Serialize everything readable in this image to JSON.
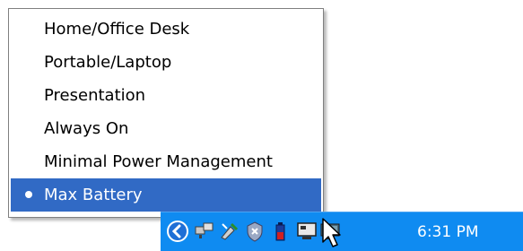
{
  "power_menu": {
    "items": [
      {
        "label": "Home/Office Desk",
        "selected": false
      },
      {
        "label": "Portable/Laptop",
        "selected": false
      },
      {
        "label": "Presentation",
        "selected": false
      },
      {
        "label": "Always On",
        "selected": false
      },
      {
        "label": "Minimal Power Management",
        "selected": false
      },
      {
        "label": "Max Battery",
        "selected": true
      }
    ]
  },
  "taskbar": {
    "clock": "6:31 PM",
    "tray_icons": [
      "show-hidden-icons-chevron-icon",
      "network-icon",
      "safely-remove-hardware-icon",
      "security-icon",
      "power-battery-icon",
      "display-icon",
      "monitor-icon"
    ]
  },
  "colors": {
    "selection": "#316ac5",
    "taskbar": "#0f8bf1",
    "menu_border": "#808080"
  }
}
